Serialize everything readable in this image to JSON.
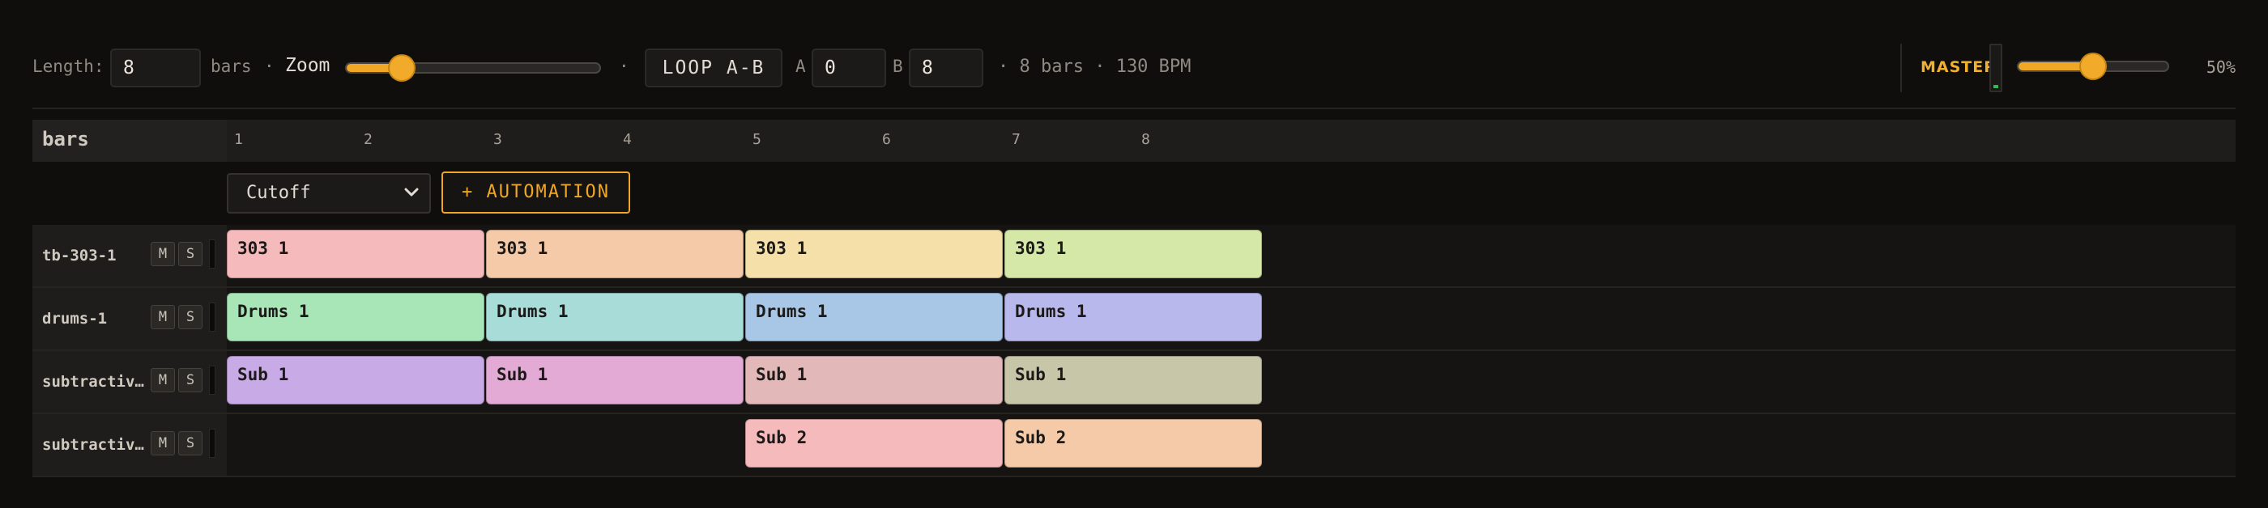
{
  "toolbar": {
    "length_label": "Length:",
    "length_value": "8",
    "bars_suffix": "bars",
    "dot": "·",
    "zoom_label": "Zoom",
    "zoom_level": 0.22,
    "loop_label": "LOOP A-B",
    "a_label": "A",
    "a_value": "0",
    "b_label": "B",
    "b_value": "8",
    "info_text": "· 8 bars · 130 BPM"
  },
  "master": {
    "label": "MASTER",
    "volume_level": 0.5,
    "volume_text": "50%"
  },
  "ruler": {
    "title": "bars",
    "numbers": [
      "1",
      "2",
      "3",
      "4",
      "5",
      "6",
      "7",
      "8"
    ]
  },
  "automation": {
    "selected": "Cutoff",
    "add_label": "+ AUTOMATION"
  },
  "tracks": [
    {
      "name": "tb-303-1",
      "mute": "M",
      "solo": "S",
      "clips": [
        {
          "label": "303 1",
          "color": "#f4babc"
        },
        {
          "label": "303 1",
          "color": "#f4caa8"
        },
        {
          "label": "303 1",
          "color": "#f4e0a8"
        },
        {
          "label": "303 1",
          "color": "#d6e8a8"
        }
      ]
    },
    {
      "name": "drums-1",
      "mute": "M",
      "solo": "S",
      "clips": [
        {
          "label": "Drums 1",
          "color": "#a8e6b8"
        },
        {
          "label": "Drums 1",
          "color": "#a8dcd8"
        },
        {
          "label": "Drums 1",
          "color": "#a8c6e6"
        },
        {
          "label": "Drums 1",
          "color": "#b8b8ec"
        }
      ]
    },
    {
      "name": "subtractiv…",
      "mute": "M",
      "solo": "S",
      "clips": [
        {
          "label": "Sub 1",
          "color": "#c8aae6"
        },
        {
          "label": "Sub 1",
          "color": "#e2aad4"
        },
        {
          "label": "Sub 1",
          "color": "#e2b8b8"
        },
        {
          "label": "Sub 1",
          "color": "#c8c6a8"
        }
      ]
    },
    {
      "name": "subtractiv…",
      "mute": "M",
      "solo": "S",
      "clips": [
        {
          "label": "Sub 2",
          "color": "#f4babc"
        },
        {
          "label": "Sub 2",
          "color": "#f4caa8"
        }
      ]
    }
  ]
}
